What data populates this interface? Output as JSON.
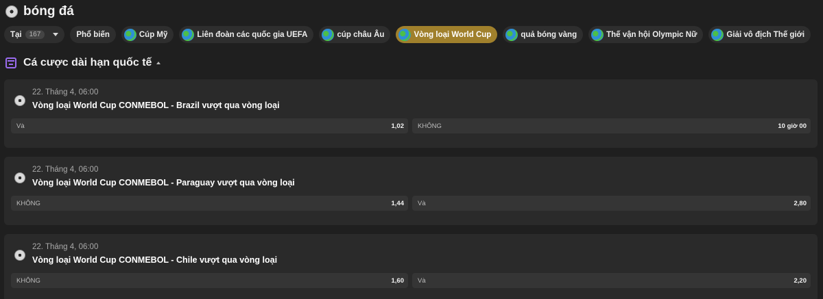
{
  "header": {
    "title": "bóng đá",
    "icon": "soccer-ball-icon"
  },
  "filters": {
    "live": {
      "label": "Tại",
      "count": "167"
    },
    "popular": "Phổ biến",
    "leagues": [
      {
        "label": "Cúp Mỹ",
        "active": false
      },
      {
        "label": "Liên đoàn các quốc gia UEFA",
        "active": false
      },
      {
        "label": "cúp châu Âu",
        "active": false
      },
      {
        "label": "Vòng loại World Cup",
        "active": true
      },
      {
        "label": "quả bóng vàng",
        "active": false
      },
      {
        "label": "Thế vận hội Olympic Nữ",
        "active": false
      },
      {
        "label": "Giải vô địch Thế giới",
        "active": false
      }
    ],
    "active_color": "#a0802c"
  },
  "section": {
    "title": "Cá cược dài hạn quốc tế",
    "icon_color": "#9b6cf0"
  },
  "events": [
    {
      "date": "22. Tháng 4, 06:00",
      "title": "Vòng loại World Cup CONMEBOL - Brazil vượt qua vòng loại",
      "left": {
        "label": "Và",
        "value": "1,02"
      },
      "right": {
        "label": "KHÔNG",
        "value": "10 giờ 00"
      }
    },
    {
      "date": "22. Tháng 4, 06:00",
      "title": "Vòng loại World Cup CONMEBOL - Paraguay vượt qua vòng loại",
      "left": {
        "label": "KHÔNG",
        "value": "1,44"
      },
      "right": {
        "label": "Và",
        "value": "2,80"
      }
    },
    {
      "date": "22. Tháng 4, 06:00",
      "title": "Vòng loại World Cup CONMEBOL - Chile vượt qua vòng loại",
      "left": {
        "label": "KHÔNG",
        "value": "1,60"
      },
      "right": {
        "label": "Và",
        "value": "2,20"
      }
    }
  ]
}
